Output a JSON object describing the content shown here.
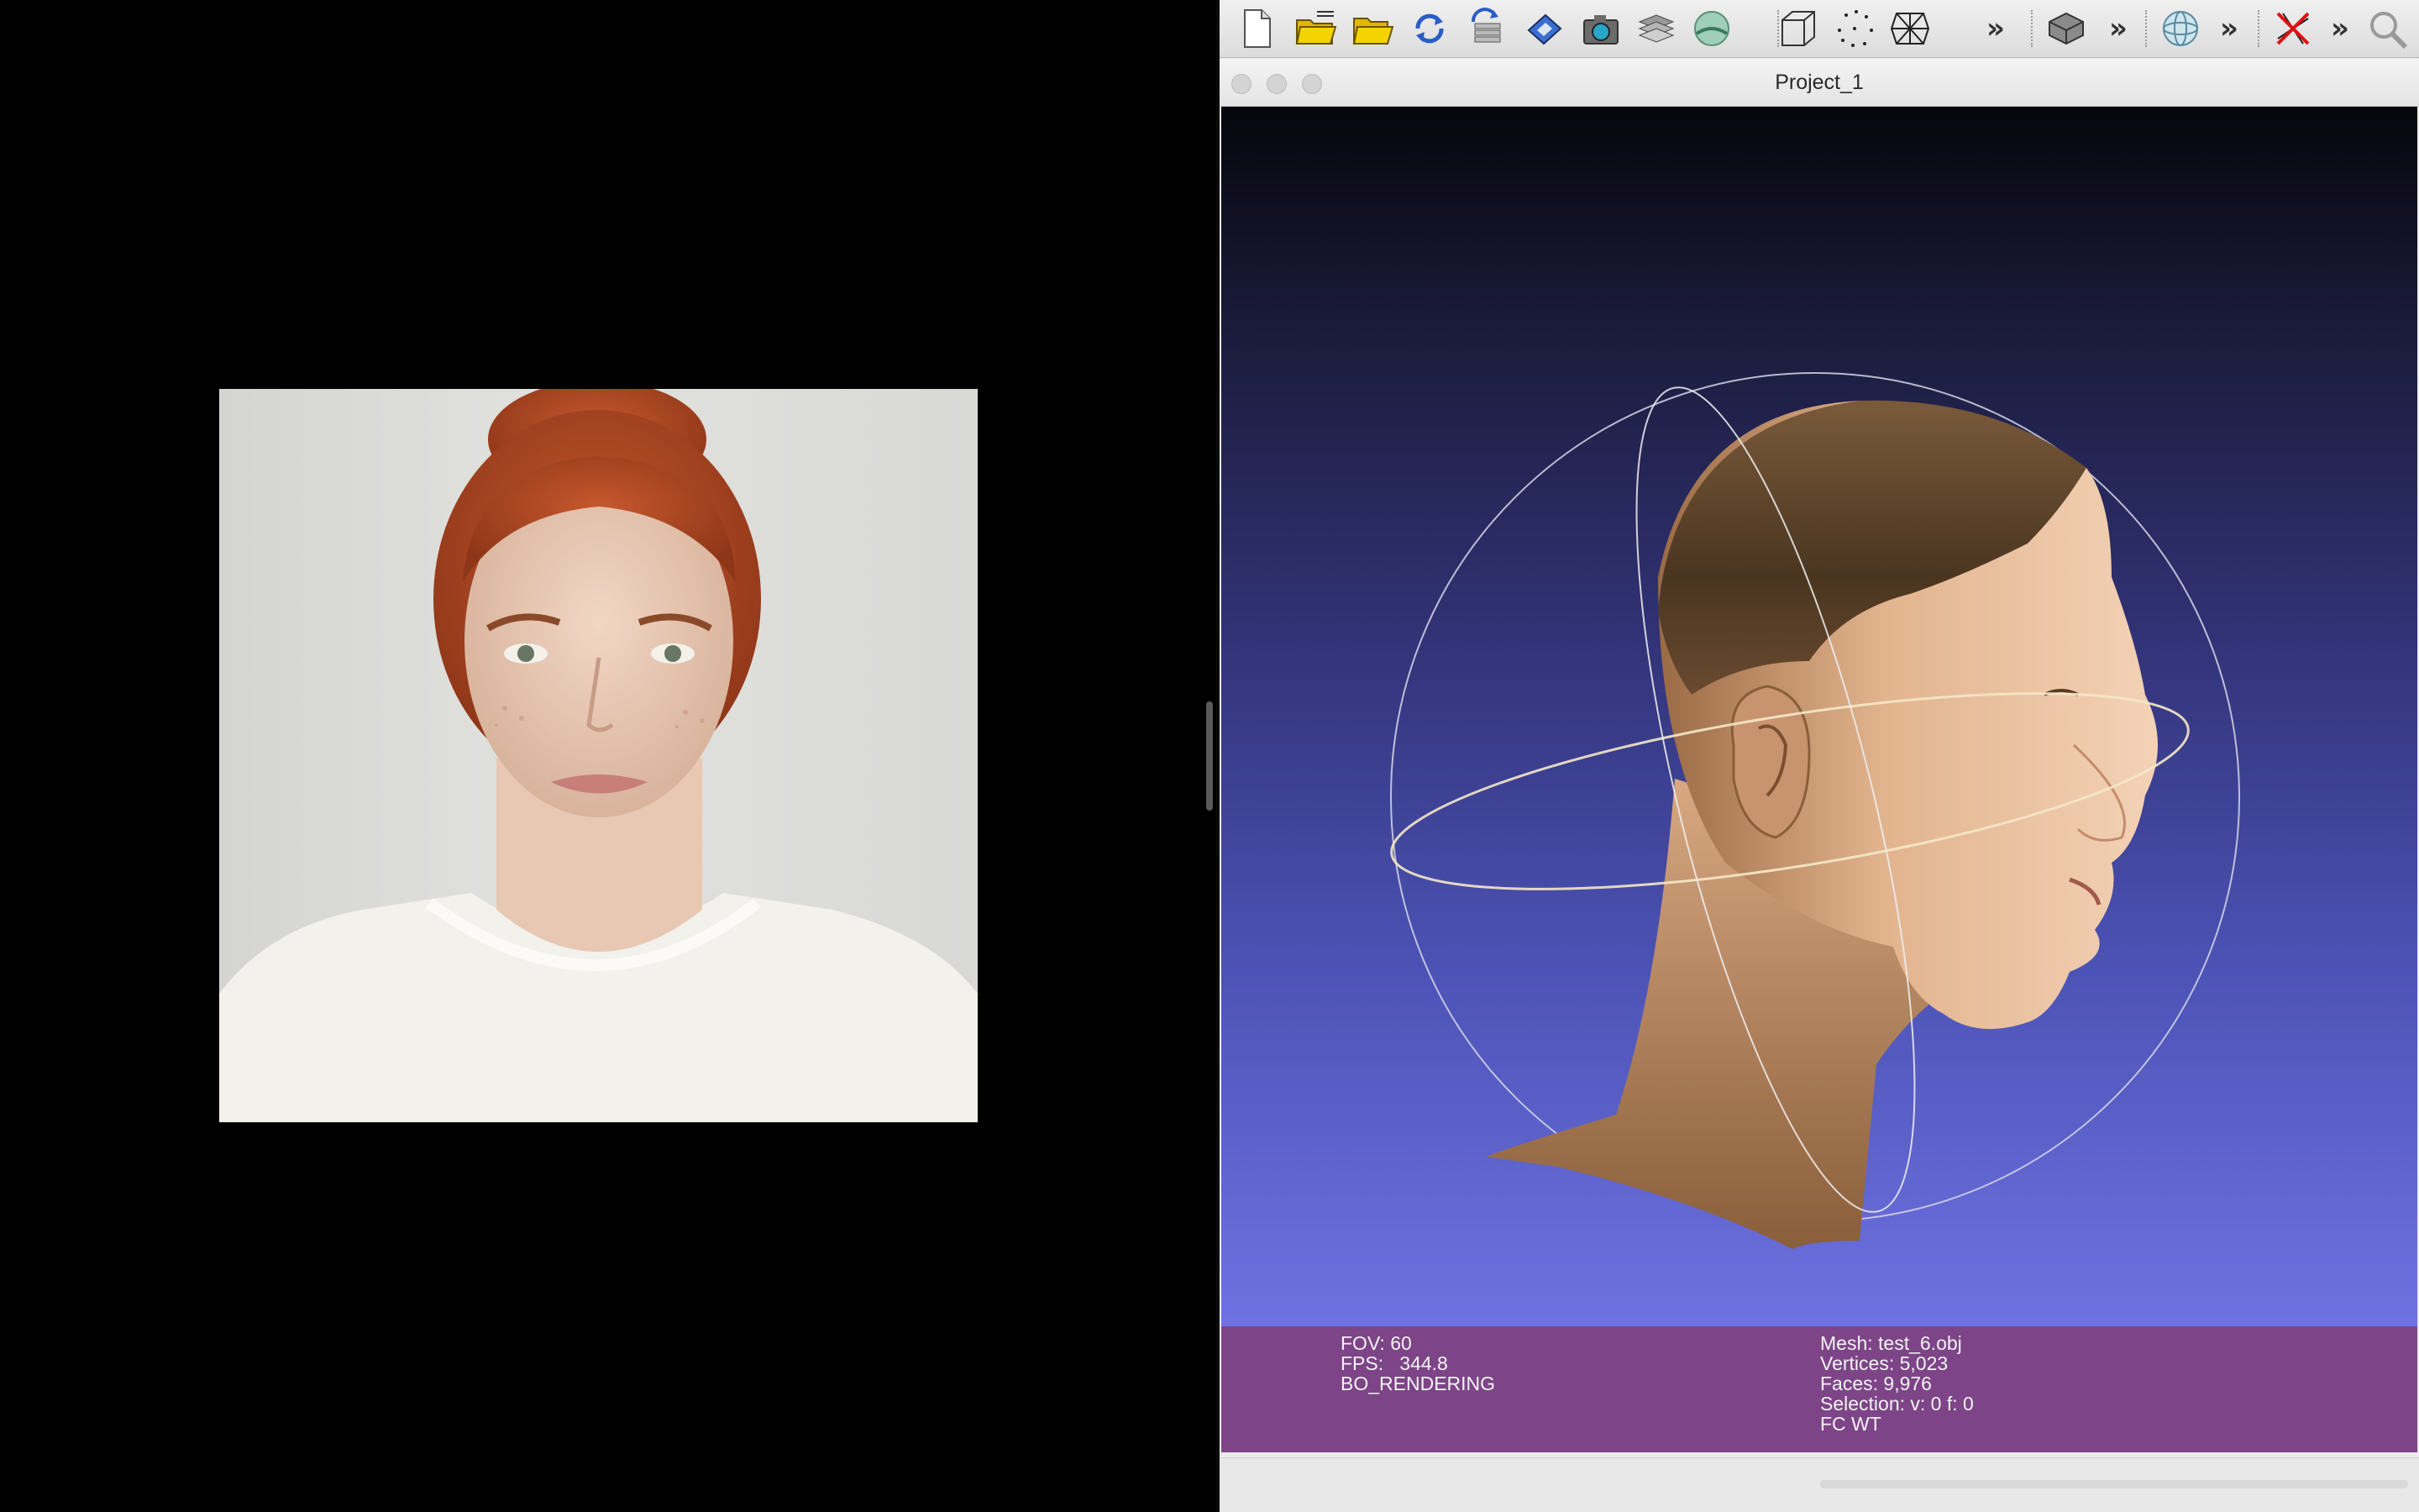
{
  "photo_viewer": {
    "image": "portrait-photo"
  },
  "app": {
    "toolbar": {
      "buttons": [
        {
          "name": "new-project",
          "icon": "blank-page-icon"
        },
        {
          "name": "open-project",
          "icon": "open-folder-layers-icon"
        },
        {
          "name": "import-mesh",
          "icon": "open-folder-icon"
        },
        {
          "name": "reload",
          "icon": "reload-arrows-icon"
        },
        {
          "name": "reload-all",
          "icon": "reload-stack-icon"
        },
        {
          "name": "export-mesh",
          "icon": "floppy-disk-icon"
        },
        {
          "name": "snapshot",
          "icon": "camera-icon"
        },
        {
          "name": "layers",
          "icon": "layer-stack-icon"
        },
        {
          "name": "raster",
          "icon": "raster-image-icon"
        },
        {
          "name": "bounding-box",
          "icon": "wire-box-icon"
        },
        {
          "name": "points",
          "icon": "point-cloud-icon"
        },
        {
          "name": "wireframe",
          "icon": "wireframe-mesh-icon"
        },
        {
          "name": "flat-shading",
          "icon": "flat-shading-icon"
        },
        {
          "name": "trackball",
          "icon": "trackball-sphere-icon"
        },
        {
          "name": "select-none",
          "icon": "select-cross-icon"
        },
        {
          "name": "search",
          "icon": "magnifier-icon"
        }
      ],
      "more_label": "»"
    },
    "window": {
      "title": "Project_1"
    },
    "info": {
      "left": {
        "fov": "FOV: 60",
        "fps": "FPS:   344.8",
        "mode": "BO_RENDERING"
      },
      "right": {
        "mesh": "Mesh: test_6.obj",
        "vertices": "Vertices: 5,023",
        "faces": "Faces: 9,976",
        "selection": "Selection: v: 0 f: 0",
        "flags": "FC WT"
      }
    },
    "colors": {
      "info_bar": "#7d4587",
      "viewport_top": "#06060c",
      "viewport_bottom": "#6e72e2"
    }
  }
}
